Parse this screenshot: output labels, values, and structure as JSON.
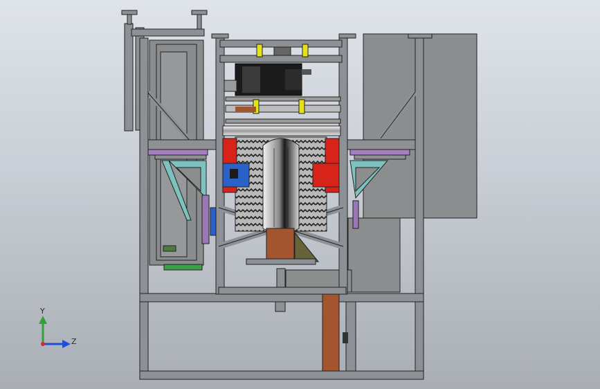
{
  "viewport": {
    "background_top": "#dfe3ea",
    "background_bottom": "#a9adb4"
  },
  "model": {
    "frame_color": "#8d9094",
    "frame_edge_color": "#2b2b2b",
    "panel_color": "#8e8f91",
    "motor_color": "#1b1b1b",
    "accent_red": "#d8231b",
    "accent_brown": "#a2552f",
    "accent_teal": "#7ec2c0",
    "accent_blue": "#2a62c8",
    "accent_yellow": "#e6e21a",
    "accent_purple": "#8b5fa6",
    "accent_green": "#39a84a"
  },
  "triad": {
    "icon": "coordinate-triad-icon",
    "y_label": "Y",
    "z_label": "Z",
    "y_color": "#34a03a",
    "z_color": "#1f4fd6",
    "origin_color": "#d42a2a"
  }
}
